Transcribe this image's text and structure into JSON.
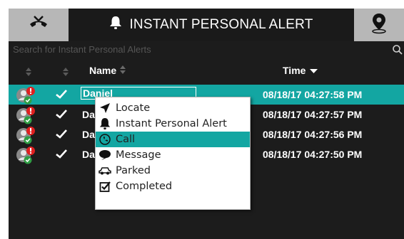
{
  "header": {
    "title": "INSTANT PERSONAL ALERT",
    "left_icon": "phone-hangup-icon",
    "right_icon": "map-pin-icon",
    "title_icon": "bell-icon"
  },
  "search": {
    "placeholder": "Search for Instant Personal Alerts",
    "value": ""
  },
  "columns": {
    "name": "Name",
    "time": "Time"
  },
  "rows": [
    {
      "name": "Daniel",
      "time": "08/18/17 04:27:58 PM",
      "selected": true
    },
    {
      "name": "Da",
      "time": "08/18/17 04:27:57 PM",
      "selected": false
    },
    {
      "name": "Da",
      "time": "08/18/17 04:27:56 PM",
      "selected": false
    },
    {
      "name": "Da",
      "time": "08/18/17 04:27:50 PM",
      "selected": false
    }
  ],
  "context_menu": {
    "items": [
      {
        "label": "Locate",
        "icon": "locate-arrow-icon"
      },
      {
        "label": "Instant Personal Alert",
        "icon": "bell-icon"
      },
      {
        "label": "Call",
        "icon": "call-icon",
        "active": true
      },
      {
        "label": "Message",
        "icon": "message-bubble-icon"
      },
      {
        "label": "Parked",
        "icon": "car-icon"
      },
      {
        "label": "Completed",
        "icon": "checkbox-icon"
      }
    ]
  },
  "colors": {
    "accent": "#13a6a2",
    "background": "#1c1c1c",
    "header_tab": "#b7b7b7",
    "alert_red": "#e02020",
    "status_green": "#2f9e44"
  }
}
